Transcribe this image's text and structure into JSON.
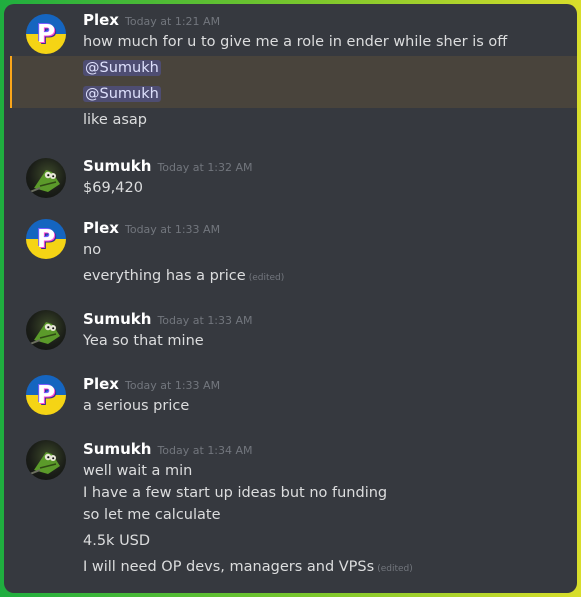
{
  "messages": [
    {
      "author": "Plex",
      "time": "Today at 1:21 AM",
      "lines": [
        "how much for u to give me a role in ender while sher is off",
        "@Sumukh",
        "@Sumukh",
        "like asap"
      ]
    },
    {
      "author": "Sumukh",
      "time": "Today at 1:32 AM",
      "lines": [
        "$69,420"
      ]
    },
    {
      "author": "Plex",
      "time": "Today at 1:33 AM",
      "lines": [
        "no",
        "everything has a price"
      ],
      "edited": "(edited)"
    },
    {
      "author": "Sumukh",
      "time": "Today at 1:33 AM",
      "lines": [
        "Yea so that mine"
      ]
    },
    {
      "author": "Plex",
      "time": "Today at 1:33 AM",
      "lines": [
        "a serious price"
      ]
    },
    {
      "author": "Sumukh",
      "time": "Today at 1:34 AM",
      "lines": [
        "well wait a min",
        "I have a few start up ideas but no funding",
        "so let me calculate",
        "4.5k USD",
        "I will need OP devs, managers and VPSs"
      ],
      "edited": "(edited)"
    }
  ],
  "avatars": {
    "plex_letter": "P"
  },
  "colors": {
    "background": "#36393f",
    "username": "#ffffff",
    "message_text": "#dcddde",
    "timestamp": "#72767d",
    "mention_highlight": "#49443c",
    "mention_border": "#faa61a",
    "frame_gradient": [
      "#1fae3f",
      "#d9de2b"
    ]
  }
}
